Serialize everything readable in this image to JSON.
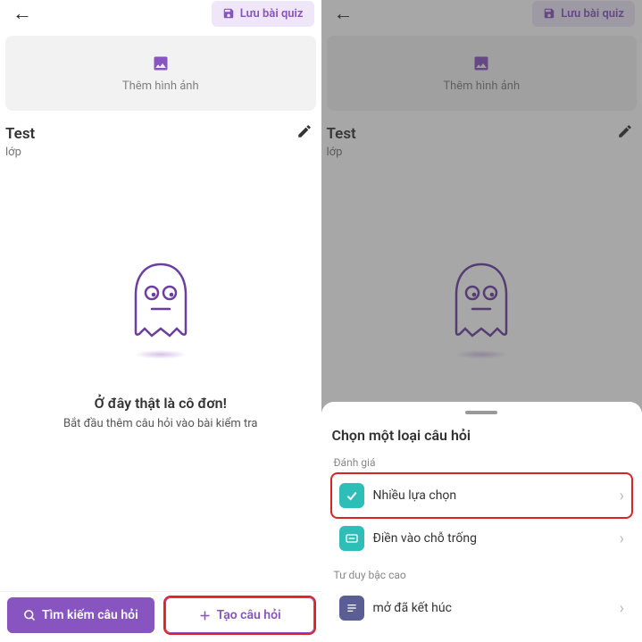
{
  "header": {
    "save_label": "Lưu bài quiz"
  },
  "image_card": {
    "add_image_label": "Thêm hình ảnh"
  },
  "quiz": {
    "title": "Test",
    "subtitle": "lớp"
  },
  "empty": {
    "title": "Ở đây thật là cô đơn!",
    "subtitle": "Bắt đầu thêm câu hỏi vào bài kiểm tra"
  },
  "bottom": {
    "search_label": "Tìm kiếm câu hỏi",
    "create_label": "Tạo câu hỏi"
  },
  "sheet": {
    "title": "Chọn một loại câu hỏi",
    "section_assessment": "Đánh giá",
    "section_higher": "Tư duy bậc cao",
    "options": {
      "multiple_choice": "Nhiều lựa chọn",
      "fill_blank": "Điền vào chỗ trống",
      "open_ended": "mở đã kết húc"
    }
  }
}
